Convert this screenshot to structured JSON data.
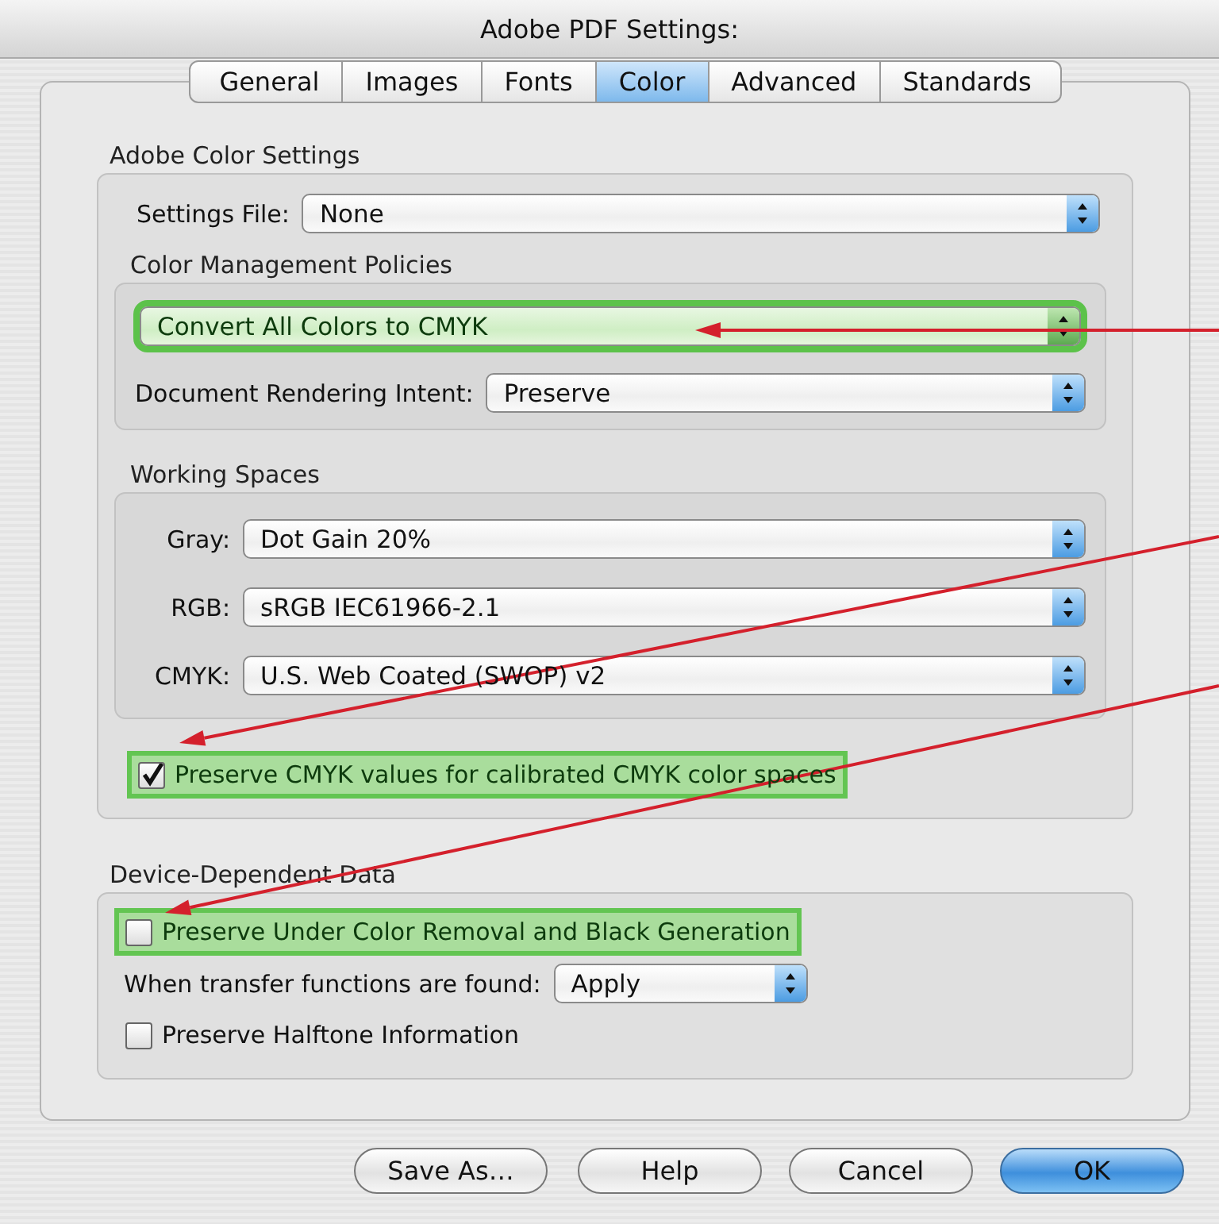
{
  "window": {
    "title": "Adobe PDF Settings:"
  },
  "tabs": [
    {
      "label": "General",
      "selected": false
    },
    {
      "label": "Images",
      "selected": false
    },
    {
      "label": "Fonts",
      "selected": false
    },
    {
      "label": "Color",
      "selected": true
    },
    {
      "label": "Advanced",
      "selected": false
    },
    {
      "label": "Standards",
      "selected": false
    }
  ],
  "color_settings": {
    "heading": "Adobe Color Settings",
    "settings_file": {
      "label": "Settings File:",
      "value": "None"
    },
    "policies": {
      "heading": "Color Management Policies",
      "conversion": {
        "value": "Convert All Colors to CMYK",
        "highlighted": true
      },
      "rendering_intent": {
        "label": "Document Rendering Intent:",
        "value": "Preserve",
        "highlighted": false
      }
    },
    "working_spaces": {
      "heading": "Working Spaces",
      "rows": [
        {
          "label": "Gray:",
          "value": "Dot Gain 20%"
        },
        {
          "label": "RGB:",
          "value": "sRGB IEC61966-2.1"
        },
        {
          "label": "CMYK:",
          "value": "U.S. Web Coated (SWOP) v2"
        }
      ]
    },
    "preserve_cmyk": {
      "label": "Preserve CMYK values for calibrated CMYK color spaces",
      "checked": true,
      "highlighted": true
    }
  },
  "device_data": {
    "heading": "Device-Dependent Data",
    "items": [
      {
        "kind": "checkbox",
        "label": "Preserve Under Color Removal and Black Generation",
        "checked": false,
        "highlighted": true
      },
      {
        "kind": "dropdown",
        "label": "When transfer functions are found:",
        "value": "Apply"
      },
      {
        "kind": "checkbox",
        "label": "Preserve Halftone Information",
        "checked": false,
        "highlighted": false
      }
    ]
  },
  "buttons": [
    {
      "label": "Save As…",
      "default": false
    },
    {
      "label": "Help",
      "default": false
    },
    {
      "label": "Cancel",
      "default": false
    },
    {
      "label": "OK",
      "default": true
    }
  ]
}
